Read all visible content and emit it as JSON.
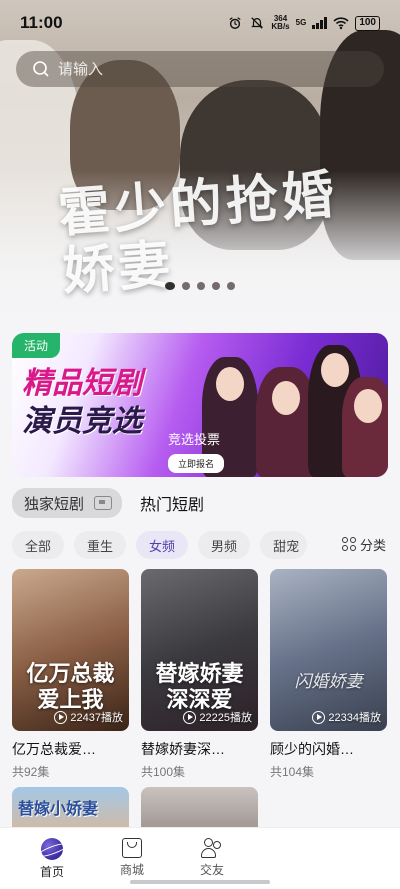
{
  "status_bar": {
    "time": "11:00",
    "net_speed": "364",
    "net_unit": "KB/s",
    "network": "5G",
    "battery": "100",
    "icons": [
      "alarm-icon",
      "mute-icon",
      "signal-icon",
      "wifi-icon",
      "battery-icon"
    ]
  },
  "search": {
    "placeholder": "请输入"
  },
  "hero": {
    "title": "霍少的抢婚娇妻",
    "carousel_count": 5,
    "carousel_active_index": 0
  },
  "promo": {
    "tag": "活动",
    "title_line1": "精品短剧",
    "title_line2": "演员竞选",
    "subtitle": "竞选投票",
    "button": "立即报名",
    "colors": {
      "tag": "#26b36a",
      "title": "#d9188a",
      "background_end": "#4c1a9a"
    }
  },
  "section_tabs": {
    "exclusive": "独家短剧",
    "hot": "热门短剧"
  },
  "chips": [
    {
      "label": "全部",
      "active": false
    },
    {
      "label": "重生",
      "active": false
    },
    {
      "label": "女频",
      "active": true
    },
    {
      "label": "男频",
      "active": false
    },
    {
      "label": "甜宠",
      "active": false
    }
  ],
  "category_label": "分类",
  "cards": [
    {
      "cover_title": "亿万总裁爱上我",
      "plays": "22437播放",
      "title": "亿万总裁爱…",
      "episodes": "共92集"
    },
    {
      "cover_title": "替嫁娇妻深深爱",
      "plays": "22225播放",
      "title": "替嫁娇妻深…",
      "episodes": "共100集"
    },
    {
      "cover_title": "闪婚娇妻",
      "plays": "22334播放",
      "title": "顾少的闪婚…",
      "episodes": "共104集"
    }
  ],
  "row2": [
    {
      "cover_title": "替嫁小娇妻"
    },
    {
      "cover_title": ""
    }
  ],
  "bottom_nav": [
    {
      "label": "首页",
      "icon": "planet-icon",
      "active": true
    },
    {
      "label": "商城",
      "icon": "shop-bag-icon",
      "active": false
    },
    {
      "label": "交友",
      "icon": "friends-icon",
      "active": false
    }
  ],
  "colors": {
    "accent": "#4b3fb0",
    "background": "#f5f5f7"
  }
}
